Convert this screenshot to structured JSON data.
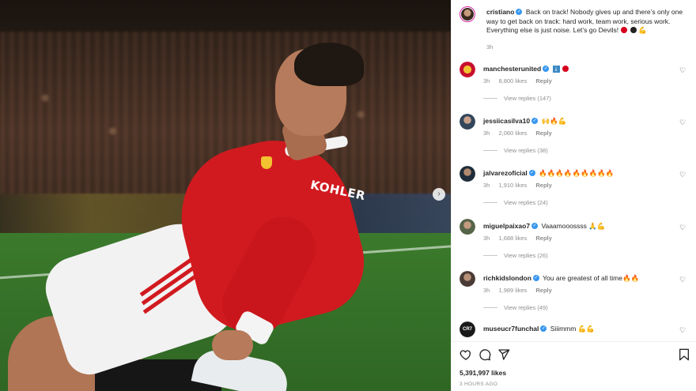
{
  "post": {
    "author": "cristiano",
    "caption": "Back on track! Nobody gives up and there’s only one way to get back on track: hard work, team work, serious work. Everything else is just noise. Let’s go Devils!",
    "time": "3h",
    "likes": "5,391,997 likes",
    "posted_ago": "3 HOURS AGO",
    "photo_overlay": {
      "sponsor_text": "KOHLER"
    }
  },
  "comments": [
    {
      "user": "manchesterunited",
      "text": "",
      "time": "3h",
      "likes": "8,800 likes",
      "reply": "Reply",
      "view_replies": "View replies (147)",
      "avatar_color": "#c8102e"
    },
    {
      "user": "jessiicasilva10",
      "text": "",
      "time": "3h",
      "likes": "2,060 likes",
      "reply": "Reply",
      "view_replies": "View replies (38)",
      "avatar_color": "#3a4f66"
    },
    {
      "user": "jalvarezoficial",
      "text": "",
      "time": "3h",
      "likes": "1,910 likes",
      "reply": "Reply",
      "view_replies": "View replies (24)",
      "avatar_color": "#2c3e50"
    },
    {
      "user": "miguelpaixao7",
      "text": "Vaaamooossss",
      "time": "3h",
      "likes": "1,688 likes",
      "reply": "Reply",
      "view_replies": "View replies (26)",
      "avatar_color": "#6b7a5a"
    },
    {
      "user": "richkidslondon",
      "text": "You are greatest of all time",
      "time": "3h",
      "likes": "1,989 likes",
      "reply": "Reply",
      "view_replies": "View replies (49)",
      "avatar_color": "#5a4a44"
    },
    {
      "user": "museucr7funchal",
      "text": "Siiimmm",
      "time": "",
      "likes": "",
      "reply": "",
      "view_replies": "",
      "avatar_color": "#1a1a1a"
    }
  ],
  "colors": {
    "verified": "#3897f0",
    "secondary_text": "#8e8e8e",
    "primary_text": "#262626"
  },
  "icons": {
    "like": "heart-icon",
    "comment": "comment-icon",
    "share": "send-icon",
    "save": "bookmark-icon",
    "next": "chevron-right-icon"
  }
}
